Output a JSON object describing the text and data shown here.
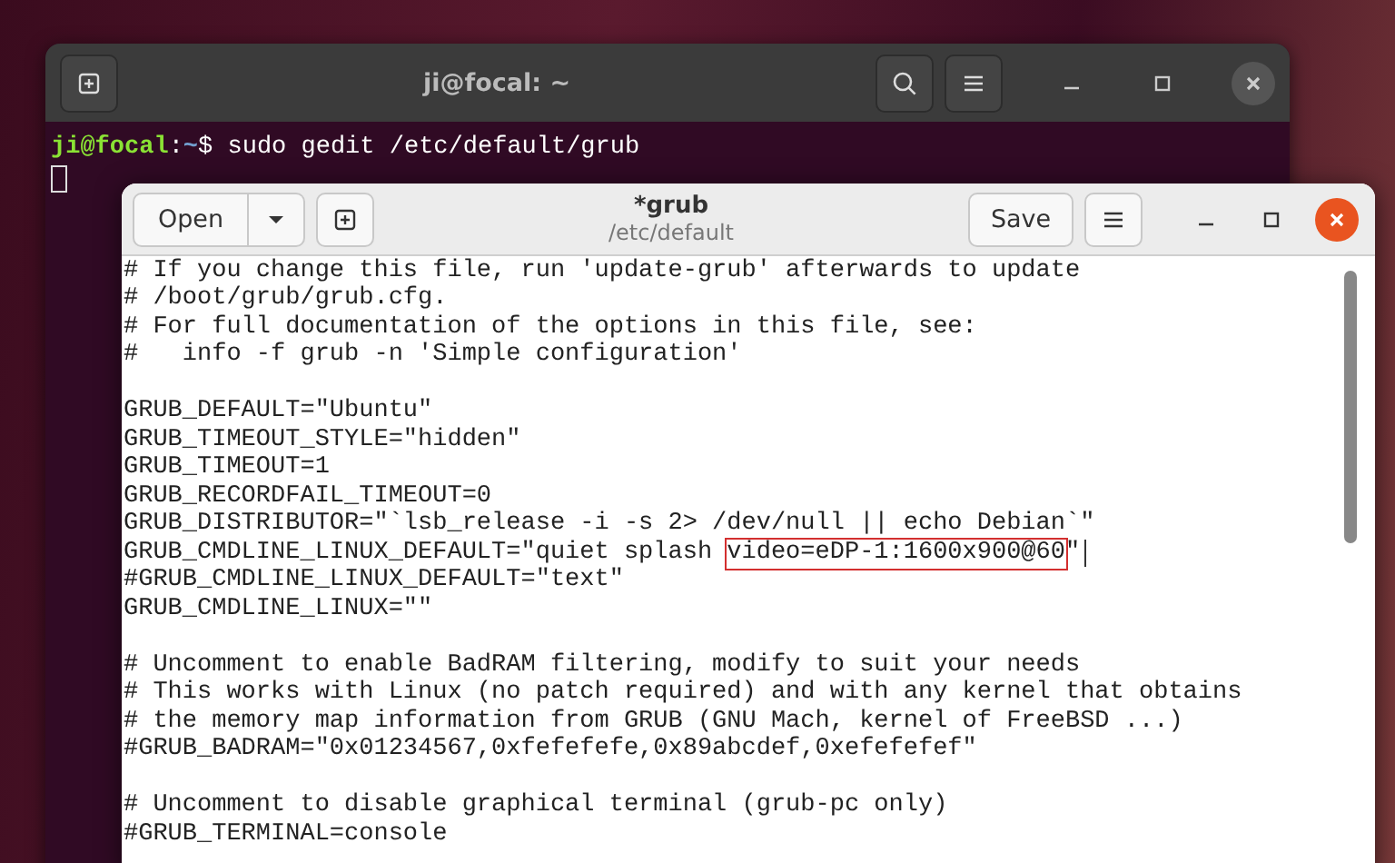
{
  "terminal": {
    "title": "ji@focal: ~",
    "prompt_user": "ji@focal",
    "prompt_sep": ":",
    "prompt_path": "~",
    "prompt_sign": "$",
    "command": "sudo gedit /etc/default/grub"
  },
  "editor": {
    "title": "*grub",
    "subtitle": "/etc/default",
    "open_label": "Open",
    "save_label": "Save",
    "lines": [
      {
        "kind": "code",
        "segments": [
          {
            "text": "# If you change this file, run 'update-grub' afterwards to update",
            "boxed": false
          }
        ]
      },
      {
        "kind": "code",
        "segments": [
          {
            "text": "# /boot/grub/grub.cfg.",
            "boxed": false
          }
        ]
      },
      {
        "kind": "code",
        "segments": [
          {
            "text": "# For full documentation of the options in this file, see:",
            "boxed": false
          }
        ]
      },
      {
        "kind": "code",
        "segments": [
          {
            "text": "#   info -f grub -n 'Simple configuration'",
            "boxed": false
          }
        ]
      },
      {
        "kind": "blank"
      },
      {
        "kind": "code",
        "segments": [
          {
            "text": "GRUB_DEFAULT=\"Ubuntu\"",
            "boxed": false
          }
        ]
      },
      {
        "kind": "code",
        "segments": [
          {
            "text": "GRUB_TIMEOUT_STYLE=\"hidden\"",
            "boxed": false
          }
        ]
      },
      {
        "kind": "code",
        "segments": [
          {
            "text": "GRUB_TIMEOUT=1",
            "boxed": false
          }
        ]
      },
      {
        "kind": "code",
        "segments": [
          {
            "text": "GRUB_RECORDFAIL_TIMEOUT=0",
            "boxed": false
          }
        ]
      },
      {
        "kind": "code",
        "segments": [
          {
            "text": "GRUB_DISTRIBUTOR=\"`lsb_release -i -s 2> /dev/null || echo Debian`\"",
            "boxed": false
          }
        ]
      },
      {
        "kind": "code",
        "cursor": true,
        "segments": [
          {
            "text": "GRUB_CMDLINE_LINUX_DEFAULT=\"quiet splash ",
            "boxed": false
          },
          {
            "text": "video=eDP-1:1600x900@60",
            "boxed": true
          },
          {
            "text": "\"",
            "boxed": false
          }
        ]
      },
      {
        "kind": "code",
        "segments": [
          {
            "text": "#GRUB_CMDLINE_LINUX_DEFAULT=\"text\"",
            "boxed": false
          }
        ]
      },
      {
        "kind": "code",
        "segments": [
          {
            "text": "GRUB_CMDLINE_LINUX=\"\"",
            "boxed": false
          }
        ]
      },
      {
        "kind": "blank"
      },
      {
        "kind": "code",
        "segments": [
          {
            "text": "# Uncomment to enable BadRAM filtering, modify to suit your needs",
            "boxed": false
          }
        ]
      },
      {
        "kind": "code",
        "segments": [
          {
            "text": "# This works with Linux (no patch required) and with any kernel that obtains",
            "boxed": false
          }
        ]
      },
      {
        "kind": "code",
        "segments": [
          {
            "text": "# the memory map information from GRUB (GNU Mach, kernel of FreeBSD ...)",
            "boxed": false
          }
        ]
      },
      {
        "kind": "code",
        "segments": [
          {
            "text": "#GRUB_BADRAM=\"0x01234567,0xfefefefe,0x89abcdef,0xefefefef\"",
            "boxed": false
          }
        ]
      },
      {
        "kind": "blank"
      },
      {
        "kind": "code",
        "segments": [
          {
            "text": "# Uncomment to disable graphical terminal (grub-pc only)",
            "boxed": false
          }
        ]
      },
      {
        "kind": "code",
        "segments": [
          {
            "text": "#GRUB_TERMINAL=console",
            "boxed": false
          }
        ]
      }
    ]
  }
}
